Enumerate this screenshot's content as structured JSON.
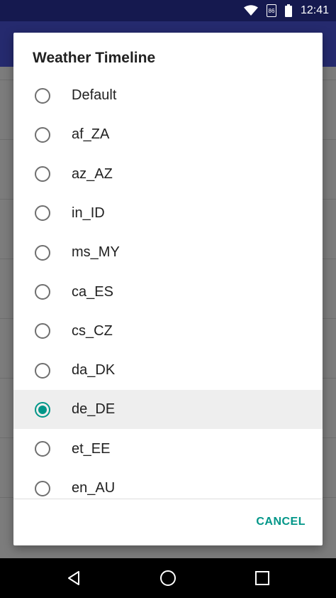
{
  "status_bar": {
    "time": "12:41",
    "sim_label": "86",
    "wifi_icon": "wifi-icon",
    "battery_icon": "battery-icon"
  },
  "dialog": {
    "title": "Weather Timeline",
    "options": [
      {
        "label": "Default",
        "selected": false
      },
      {
        "label": "af_ZA",
        "selected": false
      },
      {
        "label": "az_AZ",
        "selected": false
      },
      {
        "label": "in_ID",
        "selected": false
      },
      {
        "label": "ms_MY",
        "selected": false
      },
      {
        "label": "ca_ES",
        "selected": false
      },
      {
        "label": "cs_CZ",
        "selected": false
      },
      {
        "label": "da_DK",
        "selected": false
      },
      {
        "label": "de_DE",
        "selected": true
      },
      {
        "label": "et_EE",
        "selected": false
      },
      {
        "label": "en_AU",
        "selected": false
      }
    ],
    "cancel_label": "CANCEL",
    "accent_color": "#009688"
  },
  "nav_bar": {
    "back_icon": "back-icon",
    "home_icon": "home-icon",
    "recents_icon": "recents-icon"
  }
}
